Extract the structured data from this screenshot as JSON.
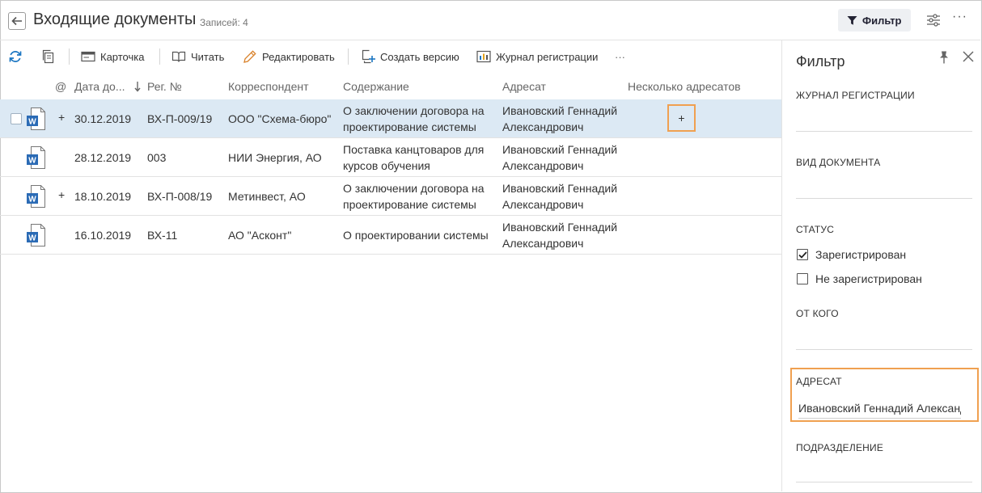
{
  "header": {
    "title": "Входящие документы",
    "records": "Записей: 4",
    "filter_label": "Фильтр",
    "more": "···"
  },
  "toolbar": {
    "card": "Карточка",
    "read": "Читать",
    "edit": "Редактировать",
    "create_version": "Создать версию",
    "registration_log": "Журнал регистрации",
    "more": "···"
  },
  "columns": {
    "at": "@",
    "date": "Дата до...",
    "reg_no": "Рег. №",
    "correspondent": "Корреспондент",
    "content": "Содержание",
    "addressee": "Адресат",
    "multiple_addressees": "Несколько адресатов"
  },
  "rows": [
    {
      "plus": "+",
      "date": "30.12.2019",
      "reg_no": "ВХ-П-009/19",
      "correspondent": "ООО \"Схема-бюро\"",
      "content": "О заключении договора на проектирование системы",
      "addressee": "Ивановский Геннадий Александрович",
      "multiple": "+"
    },
    {
      "plus": "",
      "date": "28.12.2019",
      "reg_no": "003",
      "correspondent": "НИИ Энергия, АО",
      "content": "Поставка канцтоваров для курсов обучения",
      "addressee": "Ивановский Геннадий Александрович",
      "multiple": ""
    },
    {
      "plus": "+",
      "date": "18.10.2019",
      "reg_no": "ВХ-П-008/19",
      "correspondent": "Метинвест, АО",
      "content": "О заключении договора на проектирование системы",
      "addressee": "Ивановский Геннадий Александрович",
      "multiple": ""
    },
    {
      "plus": "",
      "date": "16.10.2019",
      "reg_no": "ВХ-11",
      "correspondent": "АО \"Асконт\"",
      "content": "О проектировании системы",
      "addressee": "Ивановский Геннадий Александрович",
      "multiple": ""
    }
  ],
  "filter_panel": {
    "title": "Фильтр",
    "registration_log": "ЖУРНАЛ РЕГИСТРАЦИИ",
    "doc_type": "ВИД ДОКУМЕНТА",
    "status": "СТАТУС",
    "status_registered": "Зарегистрирован",
    "status_not_registered": "Не зарегистрирован",
    "from": "ОТ КОГО",
    "addressee": "АДРЕСАТ",
    "addressee_value": "Ивановский Геннадий Александрович",
    "department": "ПОДРАЗДЕЛЕНИЕ"
  },
  "colors": {
    "selected_row": "#dce9f4",
    "highlight": "#f0a050",
    "accent": "#1b76c2"
  }
}
